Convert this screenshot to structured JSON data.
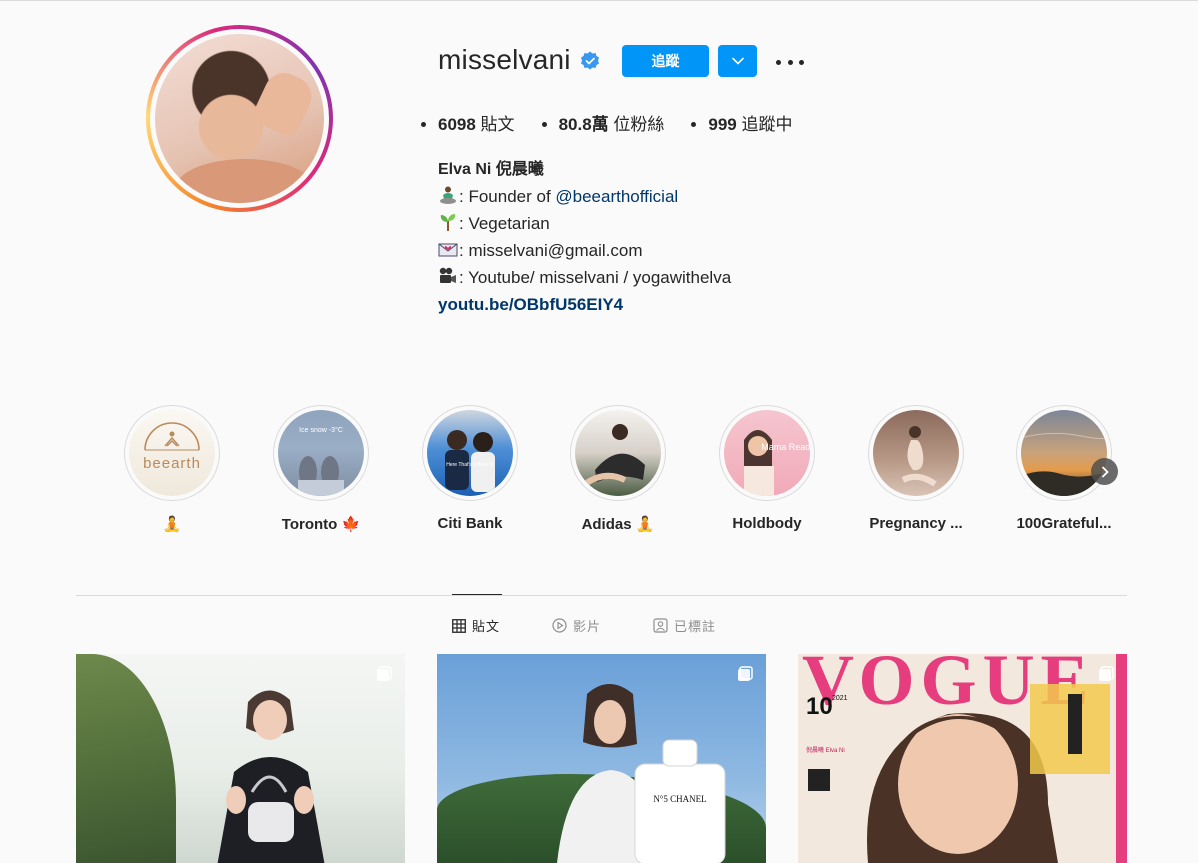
{
  "profile": {
    "username": "misselvani",
    "verified_icon": "verified-badge-icon",
    "follow_label": "追蹤",
    "stats": {
      "posts_count": "6098",
      "posts_label": " 貼文",
      "followers_count": "80.8萬",
      "followers_label": " 位粉絲",
      "following_count": "999",
      "following_label": " 追蹤中"
    },
    "bio": {
      "name": "Elva Ni 倪晨曦",
      "line1_text": ": Founder of ",
      "line1_mention": "@beearthofficial",
      "line2_text": ": Vegetarian",
      "line3_text": ": misselvani@gmail.com",
      "line4_text": ": Youtube/ misselvani / yogawithelva",
      "link": "youtu.be/OBbfU56EIY4"
    }
  },
  "highlights": [
    {
      "label": "🧘",
      "cover_text": "beearth"
    },
    {
      "label": "Toronto 🍁",
      "cover_text": "Ice snow -3°C"
    },
    {
      "label": "Citi Bank",
      "cover_text": "Here That's a Bank is"
    },
    {
      "label": "Adidas 🧘",
      "cover_text": ""
    },
    {
      "label": "Holdbody",
      "cover_text": "Mama Ready"
    },
    {
      "label": "Pregnancy ...",
      "cover_text": ""
    },
    {
      "label": "100Grateful...",
      "cover_text": ""
    }
  ],
  "tabs": [
    {
      "label": "貼文",
      "icon": "grid-icon",
      "active": true
    },
    {
      "label": "影片",
      "icon": "play-icon",
      "active": false
    },
    {
      "label": "已標註",
      "icon": "tagged-icon",
      "active": false
    }
  ],
  "posts": [
    {
      "type": "carousel"
    },
    {
      "type": "carousel",
      "caption_text": "N°5 CHANEL"
    },
    {
      "type": "carousel",
      "magazine": "VOGUE",
      "issue": "10",
      "year": "2021",
      "name": "倪晨曦 Elva Ni"
    }
  ],
  "colors": {
    "accent": "#0095f6",
    "link": "#00376b",
    "text": "#262626",
    "muted": "#8e8e8e",
    "background": "#fafafa"
  }
}
